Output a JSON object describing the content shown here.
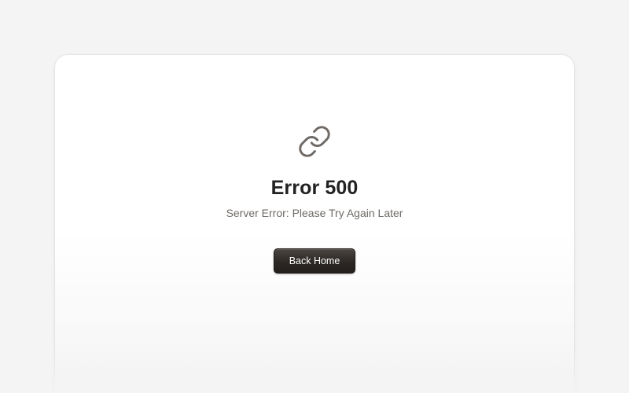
{
  "error": {
    "icon": "link-icon",
    "title": "Error 500",
    "message": "Server Error: Please Try Again Later",
    "button_label": "Back Home"
  },
  "colors": {
    "background": "#f4f4f4",
    "card": "#ffffff",
    "title": "#222222",
    "message": "#6e6a66",
    "icon": "#6f6a66",
    "button": "#2c2825",
    "button_text": "#ffffff"
  }
}
